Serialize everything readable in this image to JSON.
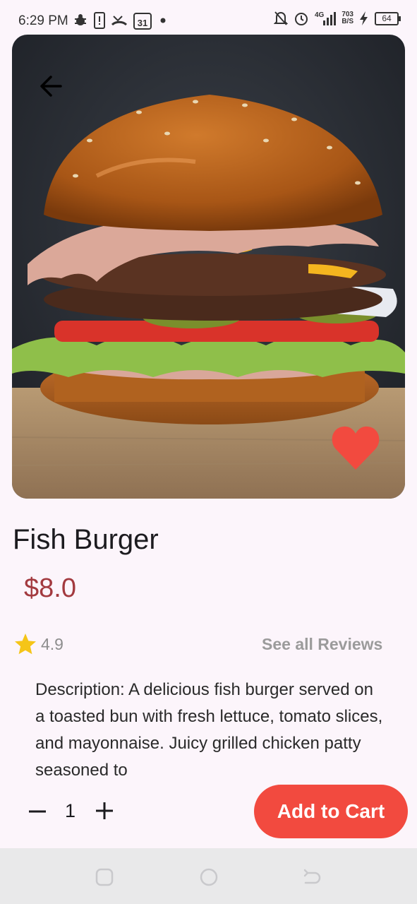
{
  "status_bar": {
    "time": "6:29 PM",
    "icons_left": [
      "bug-icon",
      "phone-sim-icon",
      "missed-call-icon",
      "calendar-icon",
      "dot-icon"
    ],
    "calendar_day": "31",
    "network_type": "4G",
    "speed_value": "703",
    "speed_unit": "B/S",
    "battery_level": "64",
    "icons_right": [
      "bell-off-icon",
      "alarm-icon",
      "signal-icon",
      "charging-icon",
      "battery-icon"
    ]
  },
  "product": {
    "title": "Fish Burger",
    "price": "$8.0",
    "rating": "4.9",
    "reviews_link": "See all Reviews",
    "description": "Description: A delicious fish burger served on a toasted bun with fresh lettuce, tomato slices, and mayonnaise. Juicy grilled chicken patty seasoned to",
    "favorite": true,
    "image": "burger-photo"
  },
  "quantity": {
    "value": "1"
  },
  "actions": {
    "add_to_cart": "Add to Cart"
  },
  "colors": {
    "accent": "#f24a3f",
    "price": "#a33a3f",
    "background": "#fcf5fb",
    "star": "#f5c518"
  },
  "nav_bar": {
    "buttons": [
      "recents-icon",
      "home-icon",
      "back-icon"
    ]
  }
}
